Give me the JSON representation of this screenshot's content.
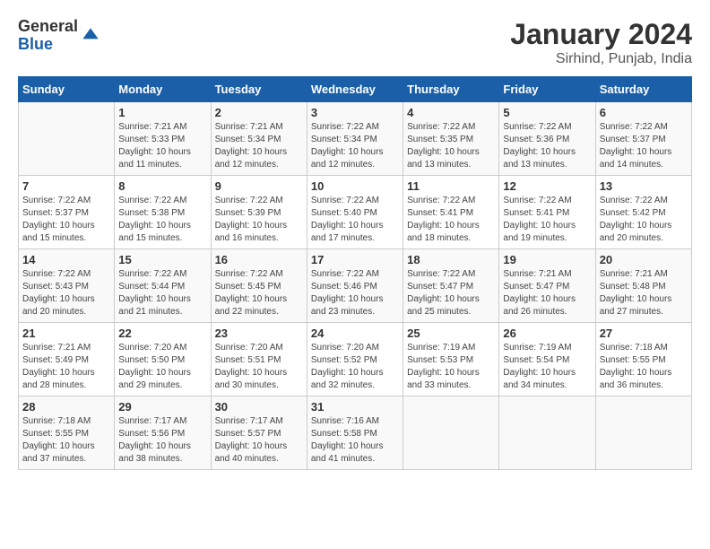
{
  "header": {
    "logo_general": "General",
    "logo_blue": "Blue",
    "month": "January 2024",
    "location": "Sirhind, Punjab, India"
  },
  "weekdays": [
    "Sunday",
    "Monday",
    "Tuesday",
    "Wednesday",
    "Thursday",
    "Friday",
    "Saturday"
  ],
  "weeks": [
    [
      {
        "day": "",
        "sunrise": "",
        "sunset": "",
        "daylight": ""
      },
      {
        "day": "1",
        "sunrise": "Sunrise: 7:21 AM",
        "sunset": "Sunset: 5:33 PM",
        "daylight": "Daylight: 10 hours and 11 minutes."
      },
      {
        "day": "2",
        "sunrise": "Sunrise: 7:21 AM",
        "sunset": "Sunset: 5:34 PM",
        "daylight": "Daylight: 10 hours and 12 minutes."
      },
      {
        "day": "3",
        "sunrise": "Sunrise: 7:22 AM",
        "sunset": "Sunset: 5:34 PM",
        "daylight": "Daylight: 10 hours and 12 minutes."
      },
      {
        "day": "4",
        "sunrise": "Sunrise: 7:22 AM",
        "sunset": "Sunset: 5:35 PM",
        "daylight": "Daylight: 10 hours and 13 minutes."
      },
      {
        "day": "5",
        "sunrise": "Sunrise: 7:22 AM",
        "sunset": "Sunset: 5:36 PM",
        "daylight": "Daylight: 10 hours and 13 minutes."
      },
      {
        "day": "6",
        "sunrise": "Sunrise: 7:22 AM",
        "sunset": "Sunset: 5:37 PM",
        "daylight": "Daylight: 10 hours and 14 minutes."
      }
    ],
    [
      {
        "day": "7",
        "sunrise": "Sunrise: 7:22 AM",
        "sunset": "Sunset: 5:37 PM",
        "daylight": "Daylight: 10 hours and 15 minutes."
      },
      {
        "day": "8",
        "sunrise": "Sunrise: 7:22 AM",
        "sunset": "Sunset: 5:38 PM",
        "daylight": "Daylight: 10 hours and 15 minutes."
      },
      {
        "day": "9",
        "sunrise": "Sunrise: 7:22 AM",
        "sunset": "Sunset: 5:39 PM",
        "daylight": "Daylight: 10 hours and 16 minutes."
      },
      {
        "day": "10",
        "sunrise": "Sunrise: 7:22 AM",
        "sunset": "Sunset: 5:40 PM",
        "daylight": "Daylight: 10 hours and 17 minutes."
      },
      {
        "day": "11",
        "sunrise": "Sunrise: 7:22 AM",
        "sunset": "Sunset: 5:41 PM",
        "daylight": "Daylight: 10 hours and 18 minutes."
      },
      {
        "day": "12",
        "sunrise": "Sunrise: 7:22 AM",
        "sunset": "Sunset: 5:41 PM",
        "daylight": "Daylight: 10 hours and 19 minutes."
      },
      {
        "day": "13",
        "sunrise": "Sunrise: 7:22 AM",
        "sunset": "Sunset: 5:42 PM",
        "daylight": "Daylight: 10 hours and 20 minutes."
      }
    ],
    [
      {
        "day": "14",
        "sunrise": "Sunrise: 7:22 AM",
        "sunset": "Sunset: 5:43 PM",
        "daylight": "Daylight: 10 hours and 20 minutes."
      },
      {
        "day": "15",
        "sunrise": "Sunrise: 7:22 AM",
        "sunset": "Sunset: 5:44 PM",
        "daylight": "Daylight: 10 hours and 21 minutes."
      },
      {
        "day": "16",
        "sunrise": "Sunrise: 7:22 AM",
        "sunset": "Sunset: 5:45 PM",
        "daylight": "Daylight: 10 hours and 22 minutes."
      },
      {
        "day": "17",
        "sunrise": "Sunrise: 7:22 AM",
        "sunset": "Sunset: 5:46 PM",
        "daylight": "Daylight: 10 hours and 23 minutes."
      },
      {
        "day": "18",
        "sunrise": "Sunrise: 7:22 AM",
        "sunset": "Sunset: 5:47 PM",
        "daylight": "Daylight: 10 hours and 25 minutes."
      },
      {
        "day": "19",
        "sunrise": "Sunrise: 7:21 AM",
        "sunset": "Sunset: 5:47 PM",
        "daylight": "Daylight: 10 hours and 26 minutes."
      },
      {
        "day": "20",
        "sunrise": "Sunrise: 7:21 AM",
        "sunset": "Sunset: 5:48 PM",
        "daylight": "Daylight: 10 hours and 27 minutes."
      }
    ],
    [
      {
        "day": "21",
        "sunrise": "Sunrise: 7:21 AM",
        "sunset": "Sunset: 5:49 PM",
        "daylight": "Daylight: 10 hours and 28 minutes."
      },
      {
        "day": "22",
        "sunrise": "Sunrise: 7:20 AM",
        "sunset": "Sunset: 5:50 PM",
        "daylight": "Daylight: 10 hours and 29 minutes."
      },
      {
        "day": "23",
        "sunrise": "Sunrise: 7:20 AM",
        "sunset": "Sunset: 5:51 PM",
        "daylight": "Daylight: 10 hours and 30 minutes."
      },
      {
        "day": "24",
        "sunrise": "Sunrise: 7:20 AM",
        "sunset": "Sunset: 5:52 PM",
        "daylight": "Daylight: 10 hours and 32 minutes."
      },
      {
        "day": "25",
        "sunrise": "Sunrise: 7:19 AM",
        "sunset": "Sunset: 5:53 PM",
        "daylight": "Daylight: 10 hours and 33 minutes."
      },
      {
        "day": "26",
        "sunrise": "Sunrise: 7:19 AM",
        "sunset": "Sunset: 5:54 PM",
        "daylight": "Daylight: 10 hours and 34 minutes."
      },
      {
        "day": "27",
        "sunrise": "Sunrise: 7:18 AM",
        "sunset": "Sunset: 5:55 PM",
        "daylight": "Daylight: 10 hours and 36 minutes."
      }
    ],
    [
      {
        "day": "28",
        "sunrise": "Sunrise: 7:18 AM",
        "sunset": "Sunset: 5:55 PM",
        "daylight": "Daylight: 10 hours and 37 minutes."
      },
      {
        "day": "29",
        "sunrise": "Sunrise: 7:17 AM",
        "sunset": "Sunset: 5:56 PM",
        "daylight": "Daylight: 10 hours and 38 minutes."
      },
      {
        "day": "30",
        "sunrise": "Sunrise: 7:17 AM",
        "sunset": "Sunset: 5:57 PM",
        "daylight": "Daylight: 10 hours and 40 minutes."
      },
      {
        "day": "31",
        "sunrise": "Sunrise: 7:16 AM",
        "sunset": "Sunset: 5:58 PM",
        "daylight": "Daylight: 10 hours and 41 minutes."
      },
      {
        "day": "",
        "sunrise": "",
        "sunset": "",
        "daylight": ""
      },
      {
        "day": "",
        "sunrise": "",
        "sunset": "",
        "daylight": ""
      },
      {
        "day": "",
        "sunrise": "",
        "sunset": "",
        "daylight": ""
      }
    ]
  ]
}
